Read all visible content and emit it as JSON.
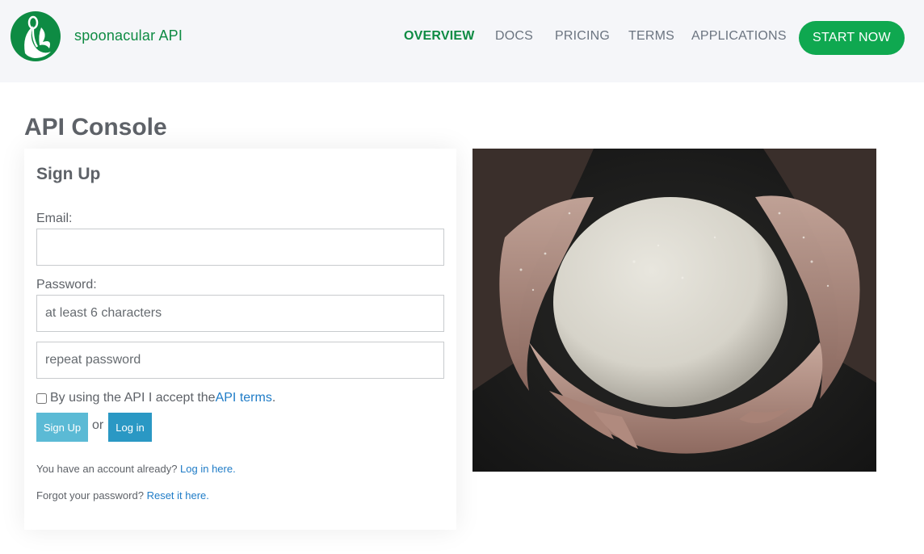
{
  "header": {
    "brand": "spoonacular API",
    "nav": [
      "OVERVIEW",
      "DOCS",
      "PRICING",
      "TERMS",
      "APPLICATIONS"
    ],
    "cta": "START NOW"
  },
  "page": {
    "title": "API Console"
  },
  "signup": {
    "title": "Sign Up",
    "email_label": "Email:",
    "email_value": "",
    "password_label": "Password:",
    "password_placeholder": "at least 6 characters",
    "repeat_placeholder": "repeat password",
    "terms_text": "By using the API I accept the ",
    "terms_link": "API terms",
    "terms_end": ".",
    "signup_button": "Sign Up",
    "or_text": "or",
    "login_button": "Log in",
    "account_text": "You have an account already? ",
    "account_link": "Log in here.",
    "forgot_text": "Forgot your password? ",
    "forgot_link": "Reset it here."
  },
  "colors": {
    "brand_green": "#0e8b43",
    "cta_green": "#0fa850",
    "link_blue": "#1f7cc7",
    "signup_button": "#5bbad5",
    "login_button": "#2a98c4"
  },
  "icons": {
    "logo": "spoon-leaf-logo-icon"
  }
}
